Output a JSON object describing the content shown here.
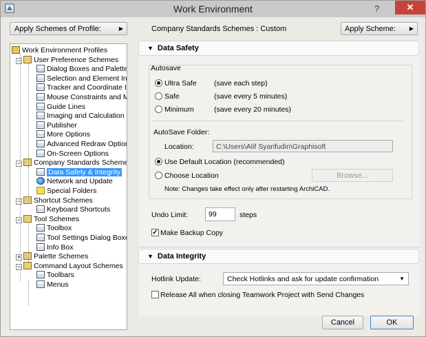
{
  "window": {
    "title": "Work Environment",
    "help": "?",
    "close": "✕"
  },
  "top": {
    "profile_button": "Apply Schemes of Profile:",
    "company_label": "Company Standards Schemes : Custom",
    "apply_button": "Apply Scheme:"
  },
  "tree": [
    {
      "label": "Work Environment Profiles",
      "level": 0,
      "icon": "profiles-icon"
    },
    {
      "label": "User Preference Schemes",
      "level": 1,
      "icon": "folder-icon",
      "expander": "−"
    },
    {
      "label": "Dialog Boxes and Palettes",
      "level": 2,
      "icon": "page-icon"
    },
    {
      "label": "Selection and Element Inform",
      "level": 2,
      "icon": "page-icon"
    },
    {
      "label": "Tracker and Coordinate Inpu",
      "level": 2,
      "icon": "page-icon"
    },
    {
      "label": "Mouse Constraints and Meth",
      "level": 2,
      "icon": "page-icon"
    },
    {
      "label": "Guide Lines",
      "level": 2,
      "icon": "page-icon"
    },
    {
      "label": "Imaging and Calculation",
      "level": 2,
      "icon": "page-icon"
    },
    {
      "label": "Publisher",
      "level": 2,
      "icon": "page-icon"
    },
    {
      "label": "More Options",
      "level": 2,
      "icon": "page-icon"
    },
    {
      "label": "Advanced Redraw Options",
      "level": 2,
      "icon": "page-icon"
    },
    {
      "label": "On-Screen Options",
      "level": 2,
      "icon": "page-icon"
    },
    {
      "label": "Company Standards Schemes",
      "level": 1,
      "icon": "folder-icon",
      "expander": "−"
    },
    {
      "label": "Data Safety & Integrity",
      "level": 2,
      "icon": "page-icon",
      "selected": true
    },
    {
      "label": "Network and Update",
      "level": 2,
      "icon": "globe-icon"
    },
    {
      "label": "Special Folders",
      "level": 2,
      "icon": "star-icon"
    },
    {
      "label": "Shortcut Schemes",
      "level": 1,
      "icon": "folder-icon",
      "expander": "−"
    },
    {
      "label": "Keyboard Shortcuts",
      "level": 2,
      "icon": "page-icon"
    },
    {
      "label": "Tool Schemes",
      "level": 1,
      "icon": "folder-icon",
      "expander": "−"
    },
    {
      "label": "Toolbox",
      "level": 2,
      "icon": "page-icon"
    },
    {
      "label": "Tool Settings Dialog Boxes",
      "level": 2,
      "icon": "page-icon"
    },
    {
      "label": "Info Box",
      "level": 2,
      "icon": "page-icon"
    },
    {
      "label": "Palette Schemes",
      "level": 1,
      "icon": "folder-icon",
      "expander": "+"
    },
    {
      "label": "Command Layout Schemes",
      "level": 1,
      "icon": "folder-icon",
      "expander": "−"
    },
    {
      "label": "Toolbars",
      "level": 2,
      "icon": "page-icon"
    },
    {
      "label": "Menus",
      "level": 2,
      "icon": "page-icon"
    }
  ],
  "data_safety": {
    "header": "Data Safety",
    "autosave_label": "Autosave",
    "options": [
      {
        "label": "Ultra Safe",
        "desc": "(save each step)",
        "selected": true
      },
      {
        "label": "Safe",
        "desc": "(save every 5 minutes)",
        "selected": false
      },
      {
        "label": "Minimum",
        "desc": "(save every 20 minutes)",
        "selected": false
      }
    ],
    "folder_label": "AutoSave Folder:",
    "location_label": "Location:",
    "location_value": "C:\\Users\\Alif Syarifudin\\Graphisoft",
    "use_default": "Use Default Location (recommended)",
    "choose_location": "Choose Location",
    "browse": "Browse...",
    "note": "Note: Changes take effect only after restarting ArchiCAD.",
    "undo_label": "Undo Limit:",
    "undo_value": "99",
    "undo_unit": "steps",
    "backup_label": "Make Backup Copy",
    "backup_checked": true
  },
  "data_integrity": {
    "header": "Data Integrity",
    "hotlink_label": "Hotlink Update:",
    "hotlink_value": "Check Hotlinks and ask for update confirmation",
    "release_label": "Release All when closing Teamwork Project with Send Changes",
    "release_checked": false
  },
  "footer": {
    "cancel": "Cancel",
    "ok": "OK"
  },
  "colors": {
    "selection": "#3399ff",
    "close": "#c8423c"
  }
}
